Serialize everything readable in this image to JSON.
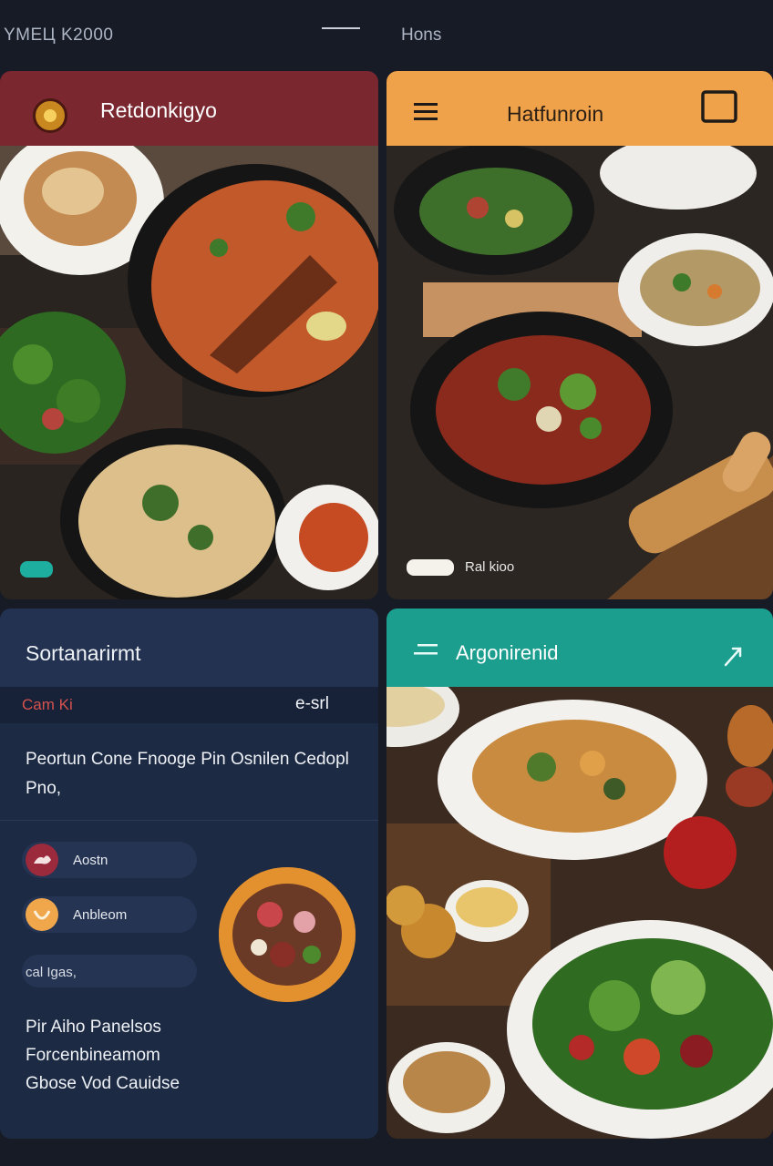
{
  "status_bar": {
    "left_text": "YMEЦ K2000",
    "right_text": "Hons"
  },
  "cards": {
    "card1": {
      "title": "Retdonkigyo",
      "chevron_icon": "chevron-down-icon",
      "logo_icon": "restaurant-logo",
      "accent": "#7a2730"
    },
    "card2": {
      "title": "Hatfunroin",
      "menu_icon": "hamburger-menu-icon",
      "square_icon": "square-icon",
      "pill_label": "Ral kioo",
      "accent": "#f0a24a"
    },
    "card3": {
      "title": "Sortanarirmt",
      "sub_left": "Cam Ki",
      "sub_right": "e-srl",
      "description": "Peortun Cone Fnooge Pin Osnilen Cedopl Pno,",
      "chips": [
        {
          "label": "Aostn",
          "icon": "sauce-drop-icon",
          "color": "#9b2a3c"
        },
        {
          "label": "Anbleom",
          "icon": "smile-icon",
          "color": "#f0a64a"
        },
        {
          "label": "cal Igas,"
        }
      ],
      "features": [
        "Pir Aiho Panelsos",
        "Forcenbineamom",
        "Gbose Vod Cauidse"
      ],
      "accent": "#223250"
    },
    "card4": {
      "title": "Argonirenid",
      "menu_icon": "menu-lines-icon",
      "arrow_icon": "arrow-up-right-icon",
      "accent": "#1c9e8f"
    }
  }
}
